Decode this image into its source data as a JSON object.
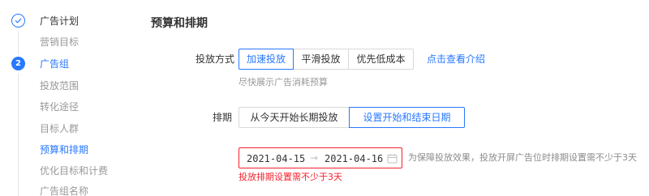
{
  "sidebar": {
    "steps": [
      {
        "label": "广告计划",
        "state": "done",
        "icon": "check-icon"
      },
      {
        "label": "广告组",
        "state": "active",
        "number": "2"
      }
    ],
    "plan_items": [
      {
        "label": "营销目标"
      }
    ],
    "group_items": [
      {
        "label": "投放范围"
      },
      {
        "label": "转化途径"
      },
      {
        "label": "目标人群"
      },
      {
        "label": "预算和排期",
        "current": true
      },
      {
        "label": "优化目标和计费"
      },
      {
        "label": "广告组名称"
      }
    ]
  },
  "main": {
    "title": "预算和排期",
    "delivery": {
      "label": "投放方式",
      "options": [
        "加速投放",
        "平滑投放",
        "优先低成本"
      ],
      "selected": "加速投放",
      "intro_link": "点击查看介绍",
      "helper": "尽快展示广告消耗预算"
    },
    "schedule": {
      "label": "排期",
      "options": [
        "从今天开始长期投放",
        "设置开始和结束日期"
      ],
      "selected": "设置开始和结束日期",
      "start_date": "2021-04-15",
      "separator": "→",
      "end_date": "2021-04-16",
      "calendar_icon": "calendar-icon",
      "note": "为保障投放效果，投放开屏广告位时排期设置需不少于3天",
      "error": "投放排期设置需不少于3天"
    }
  },
  "colors": {
    "accent": "#2878ff",
    "error": "#f5222d",
    "muted": "#999999",
    "border": "#d9d9d9"
  }
}
